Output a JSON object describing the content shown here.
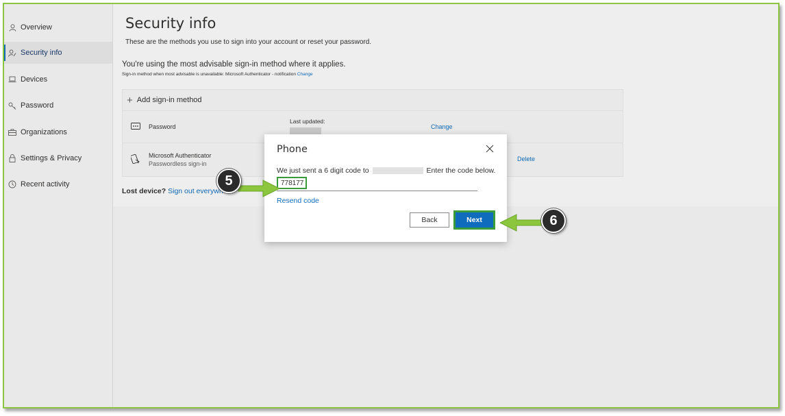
{
  "sidebar": {
    "items": [
      {
        "label": "Overview",
        "icon": "person-icon"
      },
      {
        "label": "Security info",
        "icon": "person-key-icon",
        "active": true
      },
      {
        "label": "Devices",
        "icon": "laptop-icon"
      },
      {
        "label": "Password",
        "icon": "key-icon"
      },
      {
        "label": "Organizations",
        "icon": "briefcase-icon"
      },
      {
        "label": "Settings & Privacy",
        "icon": "lock-icon"
      },
      {
        "label": "Recent activity",
        "icon": "history-icon"
      }
    ]
  },
  "main": {
    "title": "Security info",
    "subtitle": "These are the methods you use to sign into your account or reset your password.",
    "advise": "You're using the most advisable sign-in method where it applies.",
    "advise_small": "Sign-in method when most advisable is unavailable: Microsoft Authenticator - notification",
    "advise_change": "Change",
    "add_method": "Add sign-in method",
    "methods": [
      {
        "name": "Password",
        "last_updated_label": "Last updated:",
        "action": "Change"
      },
      {
        "name": "Microsoft Authenticator",
        "sub": "Passwordless sign-in",
        "action": "Delete"
      }
    ],
    "lost_device": "Lost device?",
    "sign_out": "Sign out everywhere"
  },
  "dialog": {
    "title": "Phone",
    "msg_prefix": "We just sent a 6 digit code to",
    "msg_suffix": "Enter the code below.",
    "code_value": "778177",
    "resend": "Resend code",
    "back": "Back",
    "next": "Next"
  },
  "callouts": {
    "step5": "5",
    "step6": "6"
  },
  "colors": {
    "accent": "#0f6cbd",
    "highlight": "#3a9b3a",
    "arrow": "#8cc63f",
    "frame": "#8cc63f"
  }
}
